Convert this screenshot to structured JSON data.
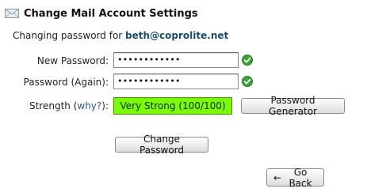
{
  "header": {
    "title": "Change Mail Account Settings",
    "icon": "mail-envelope-icon"
  },
  "subtitle": {
    "prefix": "Changing password for",
    "account": "beth@coprolite.net"
  },
  "form": {
    "new_password_label": "New Password:",
    "new_password_value": "••••••••••••",
    "password_again_label": "Password (Again):",
    "password_again_value": "••••••••••••",
    "strength_label_prefix": "Strength (",
    "strength_why": "why?",
    "strength_label_suffix": "):",
    "strength_value": "Very Strong (100/100)",
    "generator_button": "Password Generator",
    "change_button": "Change Password"
  },
  "nav": {
    "back_arrow": "←",
    "back_label": "Go Back"
  },
  "colors": {
    "strength_fill": "#7cfc00",
    "check_green": "#3aa335",
    "account_text": "#1a4e6e",
    "link": "#2a5d8a"
  }
}
